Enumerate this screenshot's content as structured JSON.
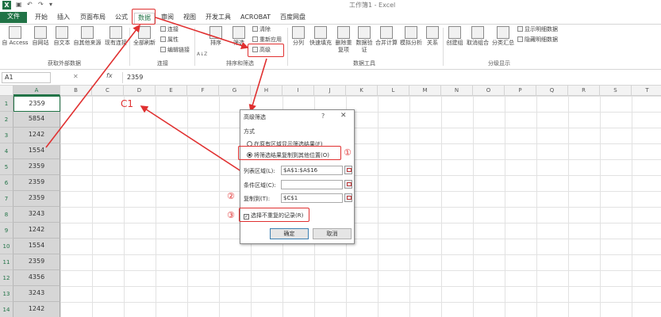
{
  "title_bar": {
    "app_icon": "X",
    "doc_title": "工作簿1 - Excel",
    "quick_access_icons": [
      "save-icon",
      "undo-icon",
      "redo-icon",
      "customize-icon"
    ]
  },
  "tabs": [
    "文件",
    "开始",
    "插入",
    "页面布局",
    "公式",
    "数据",
    "审阅",
    "视图",
    "开发工具",
    "ACROBAT",
    "百度网盘"
  ],
  "ribbon": {
    "external_data": {
      "access": "自 Access",
      "website": "自网站",
      "text": "自文本",
      "other": "自其他来源",
      "existing": "现有连接",
      "group": "获取外部数据"
    },
    "connections": {
      "refresh_all": "全部刷新",
      "connections": "连接",
      "properties": "属性",
      "edit_links": "编辑链接",
      "group": "连接"
    },
    "sort_filter": {
      "sort_az": "A↓Z",
      "sort": "排序",
      "filter": "筛选",
      "clear": "清除",
      "reapply": "重新应用",
      "advanced": "高级",
      "group": "排序和筛选"
    },
    "data_tools": {
      "split": "分列",
      "flash_fill": "快速填充",
      "remove_dup": "删除重复项",
      "validation": "数据验证",
      "consolidate": "合并计算",
      "what_if": "模拟分析",
      "relationships": "关系",
      "group": "数据工具"
    },
    "outline": {
      "group_btn": "创建组",
      "ungroup": "取消组合",
      "subtotal": "分类汇总",
      "show_detail": "显示明细数据",
      "hide_detail": "隐藏明细数据",
      "group": "分级显示"
    }
  },
  "formula_bar": {
    "name_box": "A1",
    "cancel": "✕",
    "fx": "fx",
    "value": "2359"
  },
  "columns": [
    "A",
    "B",
    "C",
    "D",
    "E",
    "F",
    "G",
    "H",
    "I",
    "J",
    "K",
    "L",
    "M",
    "N",
    "O",
    "P",
    "Q",
    "R",
    "S",
    "T"
  ],
  "rows": [
    "1",
    "2",
    "3",
    "4",
    "5",
    "6",
    "7",
    "8",
    "9",
    "10",
    "11",
    "12",
    "13",
    "14"
  ],
  "column_a": [
    "2359",
    "5854",
    "1242",
    "1554",
    "2359",
    "2359",
    "2359",
    "3243",
    "1242",
    "1554",
    "2359",
    "4356",
    "3243",
    "1242"
  ],
  "dialog": {
    "title": "高级筛选",
    "help": "?",
    "close": "✕",
    "method_label": "方式",
    "option1": "在原有区域显示筛选结果(F)",
    "option2": "将筛选结果复制到其他位置(O)",
    "list_range_label": "列表区域(L):",
    "list_range": "$A$1:$A$16",
    "criteria_label": "条件区域(C):",
    "criteria": "",
    "copy_to_label": "复制到(T):",
    "copy_to": "$C$1",
    "unique_label": "选择不重复的记录(R)",
    "ok": "确定",
    "cancel": "取消"
  },
  "annotations": {
    "c1": "C1",
    "num1": "①",
    "num2": "②",
    "num3": "③",
    "color": "#e03030"
  }
}
